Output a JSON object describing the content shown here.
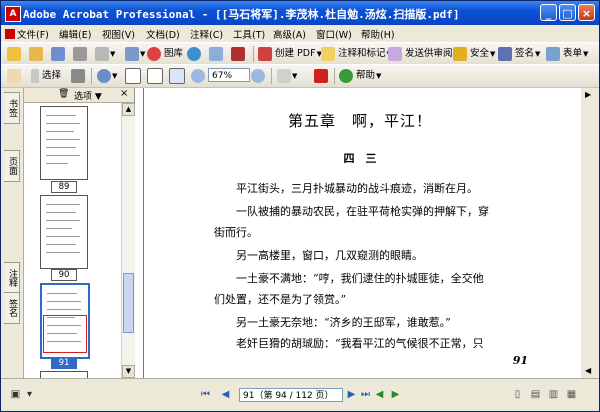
{
  "window": {
    "title": "Adobe Acrobat Professional - [[马石将军].李茂林.杜自勉.汤炫.扫描版.pdf]",
    "app_icon": "acrobat-icon",
    "controls": [
      "_",
      "□",
      "×"
    ]
  },
  "menu": {
    "items": [
      "文件(F)",
      "编辑(E)",
      "视图(V)",
      "文档(D)",
      "注释(C)",
      "工具(T)",
      "高级(A)",
      "窗口(W)",
      "帮助(H)"
    ]
  },
  "toolbar1": {
    "labels": {
      "pdf": "图库",
      "create_pdf": "创建 PDF",
      "comment": "注释和标记",
      "send_review": "发送供审阅",
      "secure": "安全",
      "sign": "签名",
      "forms": "表单"
    }
  },
  "toolbar2": {
    "select": "选择",
    "zoom": "67%",
    "help": "帮助"
  },
  "thumbnails": {
    "header": "选项",
    "pages": [
      "89",
      "90",
      "91"
    ],
    "selected": "91"
  },
  "nav_tabs": [
    "书签",
    "页面",
    "注释",
    "签名"
  ],
  "document": {
    "chapter": "第五章　啊，平江！",
    "section": "四　三",
    "paragraphs": [
      "平江街头，三月扑城暴动的战斗痕迹，消断在月。",
      "一队被捕的暴动农民，在驻平荷枪实弹的押解下，穿",
      "街而行。",
      "另一高楼里，窗口，几双窥测的眼睛。",
      "一土豪不满地：“哼，我们逮住的扑城匪徒，全交他",
      "们处置，还不是为了领赏。”",
      "另一土豪无奈地：“济乡的王邸军，谁敢惹。”",
      "老奸巨猾的胡珹励：“我看平江的气候很不正常，只"
    ],
    "page_number": "91"
  },
  "statusbar": {
    "page_field": "91（第 94 / 112 页）"
  }
}
